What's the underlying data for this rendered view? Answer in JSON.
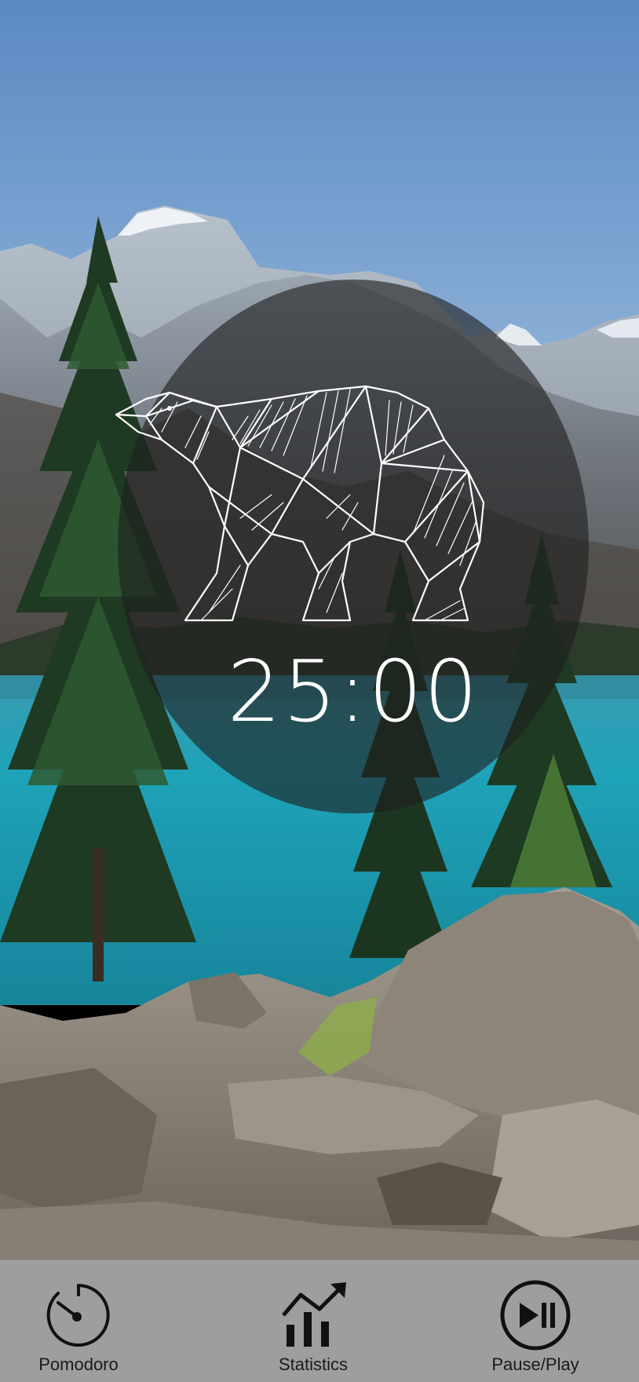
{
  "timer": {
    "display": "25:00"
  },
  "nav": {
    "items": [
      {
        "label": "Pomodoro",
        "icon": "stopwatch-icon"
      },
      {
        "label": "Statistics",
        "icon": "bar-chart-trend-icon"
      },
      {
        "label": "Pause/Play",
        "icon": "play-pause-icon"
      }
    ]
  },
  "colors": {
    "nav_background": "#9e9e9e",
    "timer_text": "#ffffff",
    "disc_overlay": "rgba(30,30,30,0.62)",
    "sky": "#5f8fc4",
    "lake": "#1f9bb0"
  },
  "background": {
    "scene": "mountain-lake-wallpaper"
  }
}
